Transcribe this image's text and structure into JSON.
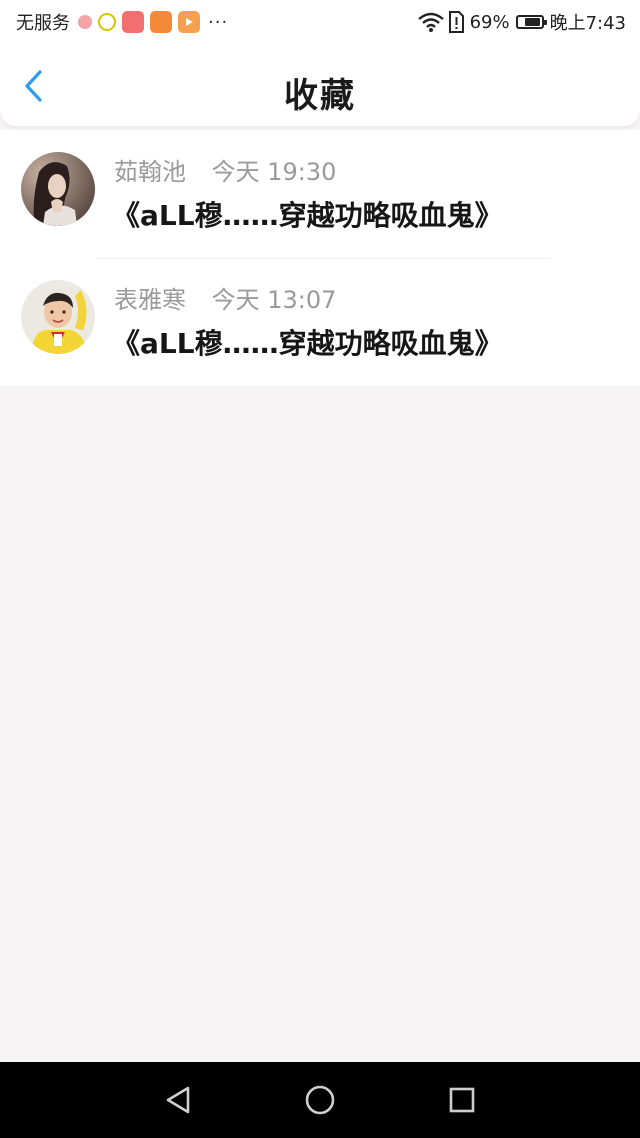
{
  "status_bar": {
    "carrier": "无服务",
    "more": "···",
    "battery_pct": "69%",
    "battery_level": 0.69,
    "clock": "晚上7:43",
    "icons": [
      "app-badge-icon",
      "app-bird-icon",
      "app-red-icon",
      "app-bookmark-icon",
      "app-play-icon",
      "wifi-icon",
      "sim-alert-icon",
      "battery-icon"
    ]
  },
  "header": {
    "back_icon": "chevron-left-icon",
    "title": "收藏"
  },
  "favorites": [
    {
      "author": "茹翰池",
      "time": "今天 19:30",
      "title": "《aLL穆……穿越功略吸血鬼》",
      "avatar_icon": "avatar-girl"
    },
    {
      "author": "表雅寒",
      "time": "今天 13:07",
      "title": "《aLL穆……穿越功略吸血鬼》",
      "avatar_icon": "avatar-boy"
    }
  ],
  "nav_bar": {
    "back_icon": "triangle-back-icon",
    "home_icon": "circle-home-icon",
    "recents_icon": "square-recents-icon"
  },
  "colors": {
    "accent": "#2a9df4",
    "background": "#f6f4f5",
    "title_text": "#161616",
    "meta_text": "#9a9a9a"
  }
}
